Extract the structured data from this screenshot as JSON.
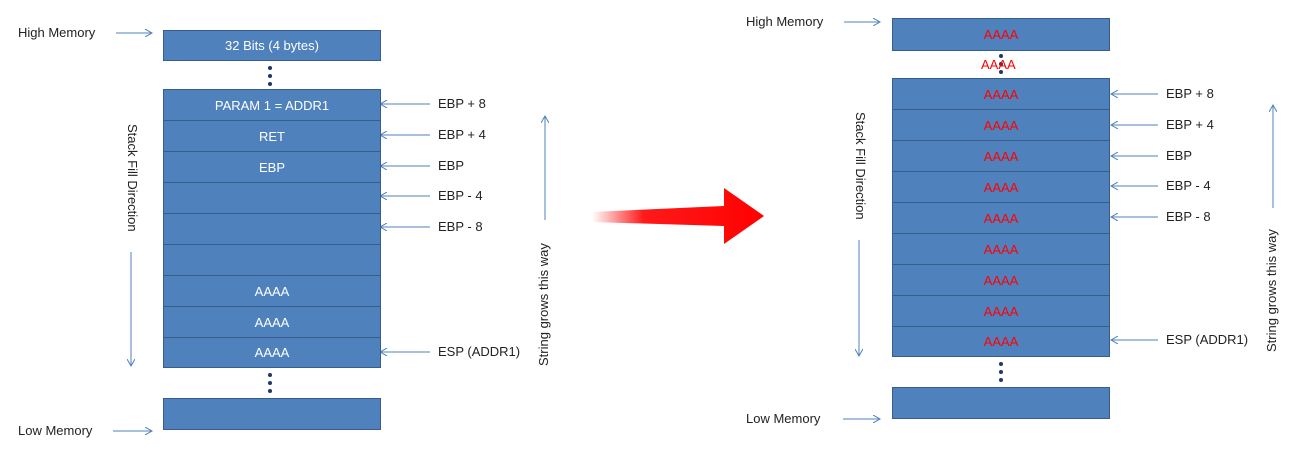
{
  "colors": {
    "cell_fill": "#4f81bd",
    "cell_border": "#385d8a",
    "arrow_line": "#4f81bd",
    "big_arrow": "#ff0000",
    "overflow_text": "#ff0000"
  },
  "left": {
    "high_memory": "High Memory",
    "low_memory": "Low Memory",
    "top_cell": "32 Bits (4 bytes)",
    "cells": [
      "PARAM 1 = ADDR1",
      "RET",
      "EBP",
      "",
      "",
      "",
      "AAAA",
      "AAAA",
      "AAAA"
    ],
    "pointer_labels": [
      "EBP + 8",
      "EBP + 4",
      "EBP",
      "EBP - 4",
      "EBP - 8",
      "ESP (ADDR1)"
    ],
    "stack_direction": "Stack Fill Direction",
    "string_direction": "String grows this way"
  },
  "right": {
    "high_memory": "High Memory",
    "low_memory": "Low Memory",
    "top_cell": "AAAA",
    "gap_text": "AAAA",
    "cells": [
      "AAAA",
      "AAAA",
      "AAAA",
      "AAAA",
      "AAAA",
      "AAAA",
      "AAAA",
      "AAAA",
      "AAAA"
    ],
    "pointer_labels": [
      "EBP + 8",
      "EBP + 4",
      "EBP",
      "EBP - 4",
      "EBP - 8",
      "ESP (ADDR1)"
    ],
    "stack_direction": "Stack Fill Direction",
    "string_direction": "String grows this way"
  }
}
